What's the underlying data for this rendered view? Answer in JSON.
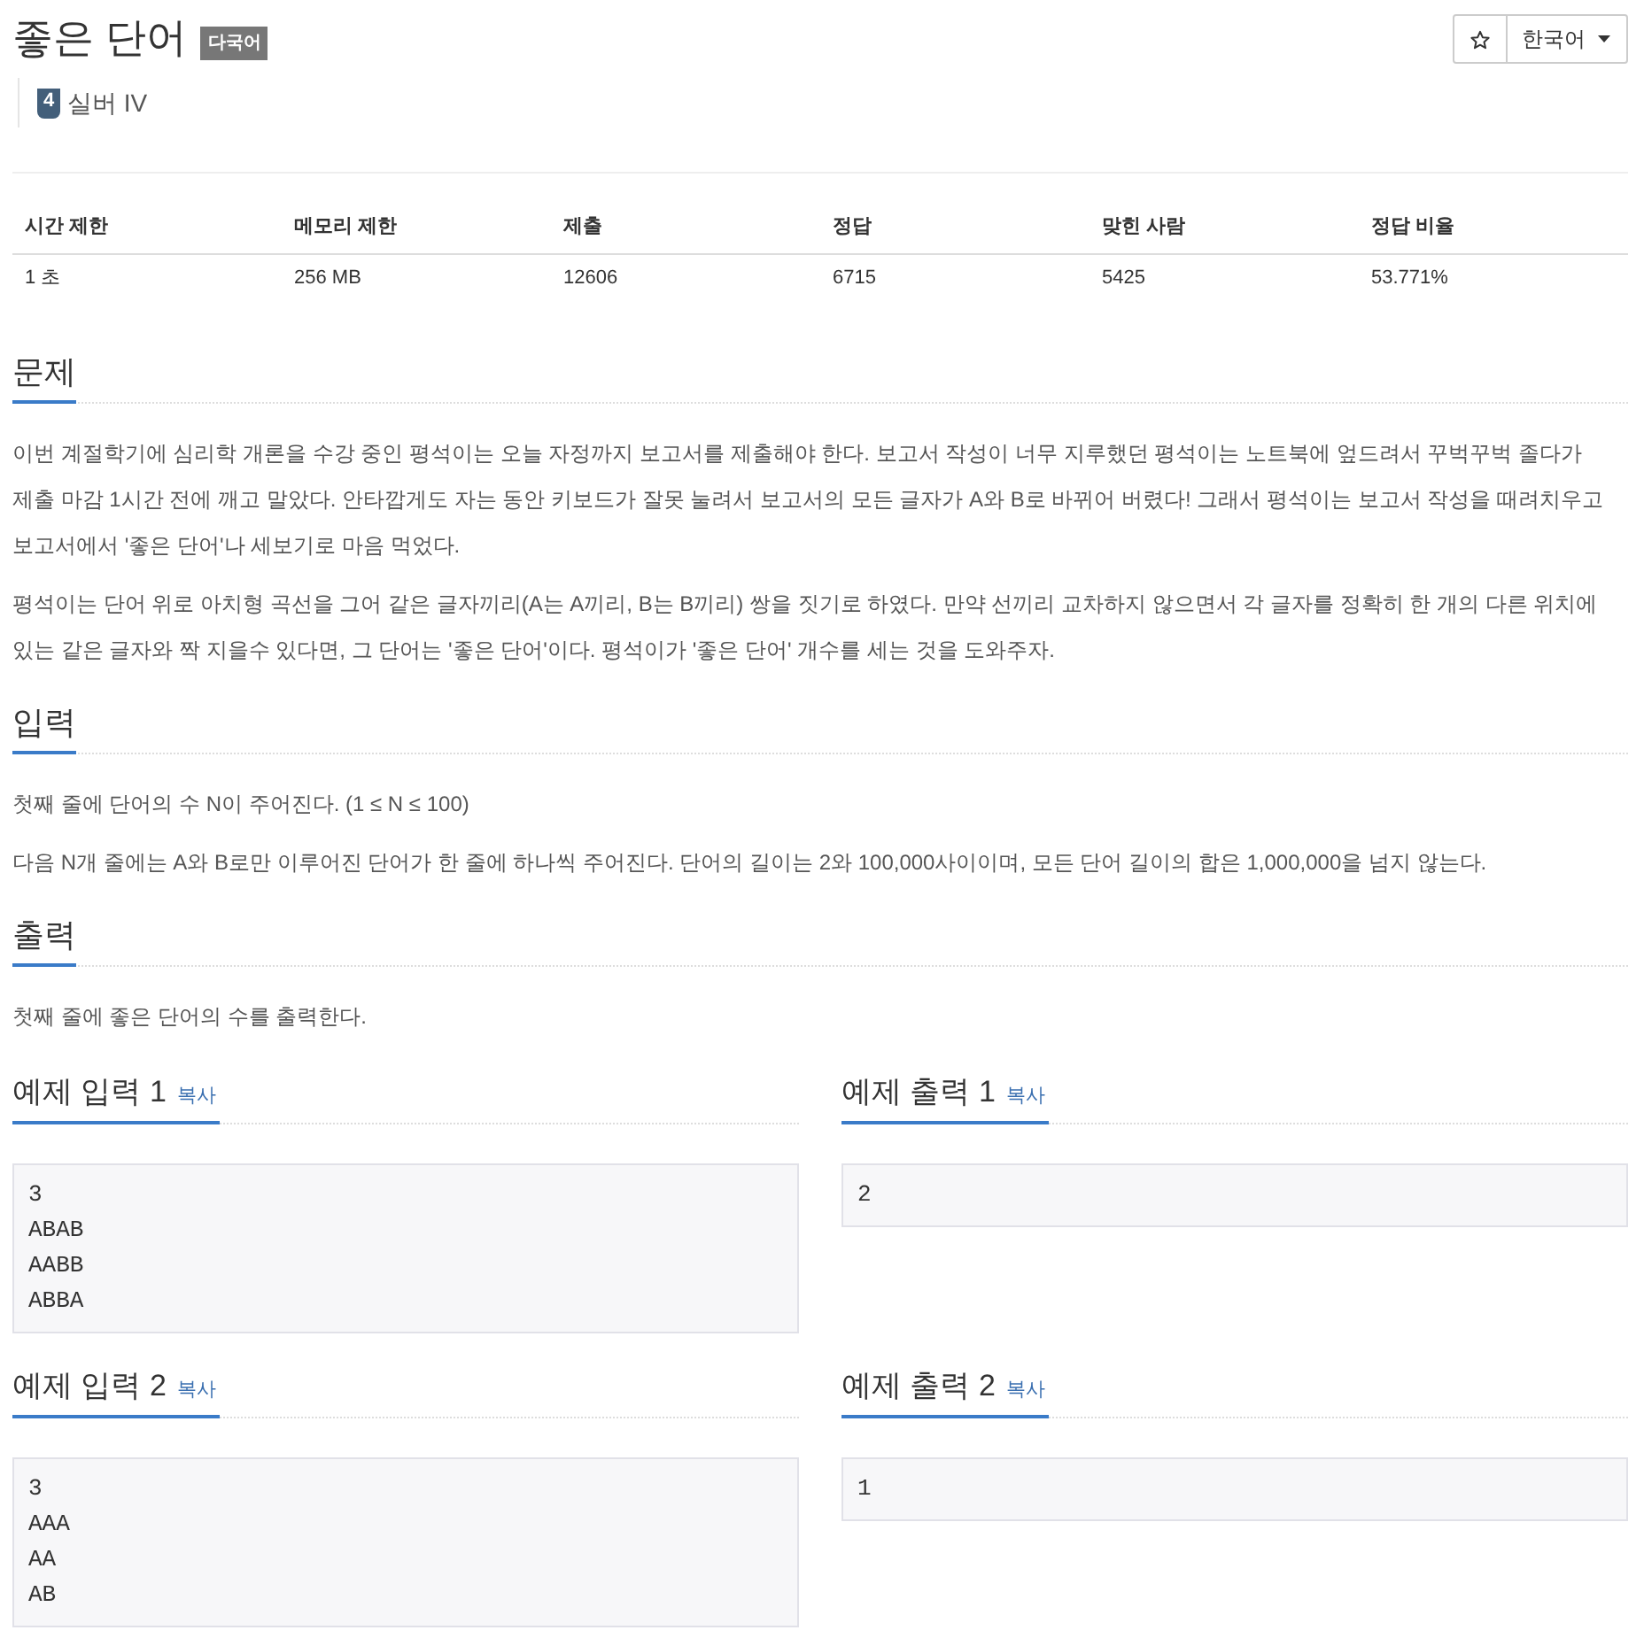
{
  "problem": {
    "title": "좋은 단어",
    "badge": "다국어"
  },
  "actions": {
    "language": "한국어"
  },
  "tier": {
    "number": "4",
    "label": "실버 IV"
  },
  "stats": {
    "columns": [
      "시간 제한",
      "메모리 제한",
      "제출",
      "정답",
      "맞힌 사람",
      "정답 비율"
    ],
    "rows": [
      [
        "1 초",
        "256 MB",
        "12606",
        "6715",
        "5425",
        "53.771%"
      ]
    ]
  },
  "sections": [
    {
      "heading": "문제",
      "paragraphs": [
        "이번 계절학기에 심리학 개론을 수강 중인 평석이는 오늘 자정까지 보고서를 제출해야 한다. 보고서 작성이 너무 지루했던 평석이는 노트북에 엎드려서 꾸벅꾸벅 졸다가 제출 마감 1시간 전에 깨고 말았다. 안타깝게도 자는 동안 키보드가 잘못 눌려서 보고서의 모든 글자가 A와 B로 바뀌어 버렸다! 그래서 평석이는 보고서 작성을 때려치우고 보고서에서 '좋은 단어'나 세보기로 마음 먹었다.",
        "평석이는 단어 위로 아치형 곡선을 그어 같은 글자끼리(A는 A끼리, B는 B끼리) 쌍을 짓기로 하였다. 만약 선끼리 교차하지 않으면서 각 글자를 정확히 한 개의 다른 위치에 있는 같은 글자와 짝 지을수 있다면, 그 단어는 '좋은 단어'이다. 평석이가 '좋은 단어' 개수를 세는 것을 도와주자."
      ]
    },
    {
      "heading": "입력",
      "paragraphs": [
        "첫째 줄에 단어의 수 N이 주어진다. (1 ≤ N ≤ 100)",
        "다음 N개 줄에는 A와 B로만 이루어진 단어가 한 줄에 하나씩 주어진다. 단어의 길이는 2와 100,000사이이며, 모든 단어 길이의 합은 1,000,000을 넘지 않는다."
      ]
    },
    {
      "heading": "출력",
      "paragraphs": [
        "첫째 줄에 좋은 단어의 수를 출력한다."
      ]
    }
  ],
  "samples": [
    {
      "heading": "예제 입력 1",
      "copy": "복사",
      "lines": [
        "3",
        "ABAB",
        "AABB",
        "ABBA"
      ]
    },
    {
      "heading": "예제 출력 1",
      "copy": "복사",
      "lines": [
        "2"
      ]
    },
    {
      "heading": "예제 입력 2",
      "copy": "복사",
      "lines": [
        "3",
        "AAA",
        "AA",
        "AB"
      ]
    },
    {
      "heading": "예제 출력 2",
      "copy": "복사",
      "lines": [
        "1"
      ]
    }
  ]
}
